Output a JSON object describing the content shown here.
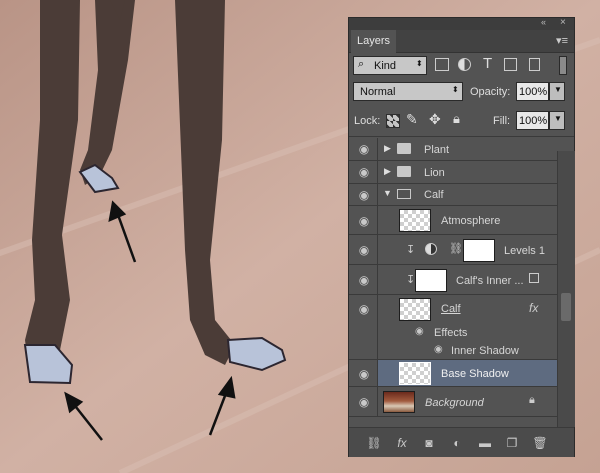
{
  "colors": {
    "panel_bg": "#535353",
    "selected_row": "#5e6b80",
    "floor": "#c9a697",
    "legs": "#4a3b36"
  },
  "panel": {
    "title": "Layers",
    "menu_icon": "panel-menu-icon",
    "collapse_icon": "double-chevron-icon",
    "close_icon": "close-icon"
  },
  "filter": {
    "search_glyph": "⌕",
    "kind_label": "Kind",
    "icons": [
      "image-filter-icon",
      "adjustment-filter-icon",
      "type-filter-icon",
      "shape-filter-icon",
      "smart-object-filter-icon"
    ]
  },
  "blend": {
    "mode": "Normal",
    "opacity_label": "Opacity:",
    "opacity_value": "100%"
  },
  "lock": {
    "label": "Lock:",
    "fill_label": "Fill:",
    "fill_value": "100%"
  },
  "layers": [
    {
      "name": "Plant",
      "type": "group",
      "expanded": false
    },
    {
      "name": "Lion",
      "type": "group",
      "expanded": false
    },
    {
      "name": "Calf",
      "type": "group",
      "expanded": true
    },
    {
      "name": "Atmosphere",
      "type": "layer"
    },
    {
      "name": "Levels 1",
      "type": "adjustment"
    },
    {
      "name": "Calf's Inner ...",
      "type": "smart-clipped"
    },
    {
      "name": "Calf",
      "type": "layer",
      "fx": "fx"
    },
    {
      "name": "Effects",
      "type": "effects-header"
    },
    {
      "name": "Inner Shadow",
      "type": "effect"
    },
    {
      "name": "Base Shadow",
      "type": "layer",
      "selected": true
    },
    {
      "name": "Background",
      "type": "background",
      "locked": true
    }
  ],
  "bottom_bar": [
    "link-layers-icon",
    "fx",
    "add-mask-icon",
    "new-adjustment-icon",
    "new-group-icon",
    "new-layer-icon",
    "delete-icon"
  ]
}
